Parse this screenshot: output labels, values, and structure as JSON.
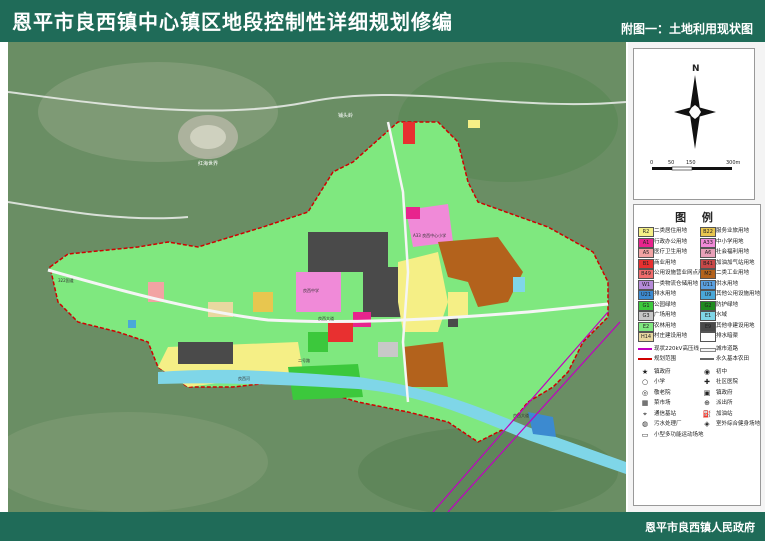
{
  "header": {
    "title": "恩平市良西镇中心镇区地段控制性详细规划修编",
    "subtitle": "附图一：土地利用现状图"
  },
  "compass": {
    "north": "N",
    "scale_labels": [
      "0",
      "50",
      "150",
      "300m"
    ]
  },
  "legend": {
    "title": "图 例",
    "items": [
      {
        "code": "R2",
        "label": "二类居住用地",
        "color": "#f5ef86"
      },
      {
        "code": "B22",
        "label": "服务业旅用地",
        "color": "#e8c64f"
      },
      {
        "code": "A1",
        "label": "行政办公用地",
        "color": "#e8248d"
      },
      {
        "code": "A33",
        "label": "中小学用地",
        "color": "#f08ad8"
      },
      {
        "code": "A5",
        "label": "医疗卫生用地",
        "color": "#f2a3a3"
      },
      {
        "code": "A6",
        "label": "社会福利用地",
        "color": "#e8a0b8"
      },
      {
        "code": "B1",
        "label": "商业用地",
        "color": "#e83030"
      },
      {
        "code": "B41",
        "label": "加油加气站用地",
        "color": "#c84848"
      },
      {
        "code": "B49",
        "label": "公用设施营业网点用地",
        "color": "#f06c6c"
      },
      {
        "code": "M2",
        "label": "二类工业用地",
        "color": "#b3621c"
      },
      {
        "code": "W1",
        "label": "一类物流仓储用地",
        "color": "#b58ad8"
      },
      {
        "code": "U11",
        "label": "供水用地",
        "color": "#5aa0e0"
      },
      {
        "code": "U21",
        "label": "排水用地",
        "color": "#3c8ad0"
      },
      {
        "code": "U9",
        "label": "其他公用设施用地",
        "color": "#4aa8d8"
      },
      {
        "code": "G1",
        "label": "公园绿地",
        "color": "#3cc83c"
      },
      {
        "code": "G2",
        "label": "防护绿地",
        "color": "#1e8a1e"
      },
      {
        "code": "G3",
        "label": "广场用地",
        "color": "#c8c8c8"
      },
      {
        "code": "E1",
        "label": "水域",
        "color": "#7fd6e8"
      },
      {
        "code": "E2",
        "label": "农林用地",
        "color": "#7fe87f"
      },
      {
        "code": "E9",
        "label": "其他非建设用地",
        "color": "#4a4a4a"
      },
      {
        "code": "H14",
        "label": "村庄建设用地",
        "color": "#e8d8a0"
      },
      {
        "code": "",
        "label": "排水暗渠",
        "color": "#ffffff"
      }
    ],
    "lines": [
      {
        "label": "现状220kV高压线",
        "color": "#c000c0"
      },
      {
        "label": "城市道路",
        "color": "#f5f5f5"
      },
      {
        "label": "规划范围",
        "color": "#d00000"
      },
      {
        "label": "永久基本农田",
        "color": "#666666"
      }
    ],
    "symbols": [
      {
        "label": "镇政府",
        "icon": "star-icon"
      },
      {
        "label": "初中",
        "icon": "middle-school-icon"
      },
      {
        "label": "小学",
        "icon": "primary-school-icon"
      },
      {
        "label": "社区医院",
        "icon": "clinic-icon"
      },
      {
        "label": "敬老院",
        "icon": "elderly-home-icon"
      },
      {
        "label": "镇政府",
        "icon": "government-icon"
      },
      {
        "label": "菜市场",
        "icon": "market-icon"
      },
      {
        "label": "派出所",
        "icon": "police-icon"
      },
      {
        "label": "通信基站",
        "icon": "tower-icon"
      },
      {
        "label": "加油站",
        "icon": "gas-station-icon"
      },
      {
        "label": "污水处理厂",
        "icon": "sewage-plant-icon"
      },
      {
        "label": "室外综合健身场地",
        "icon": "fitness-icon"
      },
      {
        "label": "小型多功能运动场地",
        "icon": "sports-field-icon"
      }
    ]
  },
  "map": {
    "labels": {
      "venue": "红海世界",
      "ridge": "铺头岭",
      "road_north": "良西大道",
      "road_south": "二号路",
      "road_diag": "良西大道",
      "road_west": "322国道",
      "river_label": "良西河",
      "school": "良西中学",
      "school_primary": "A33 良西中心小学"
    },
    "colors": {
      "farmland": "#7fe87f",
      "residential": "#f5ef86",
      "industrial": "#b3621c",
      "park": "#3cc83c",
      "protective": "#1e8a1e",
      "other": "#4a4a4a",
      "water": "#7fd6e8",
      "boundary": "#d00000",
      "powerline": "#c000c0",
      "road": "#f5f5f5"
    }
  },
  "footer": {
    "issuer": "恩平市良西镇人民政府"
  }
}
